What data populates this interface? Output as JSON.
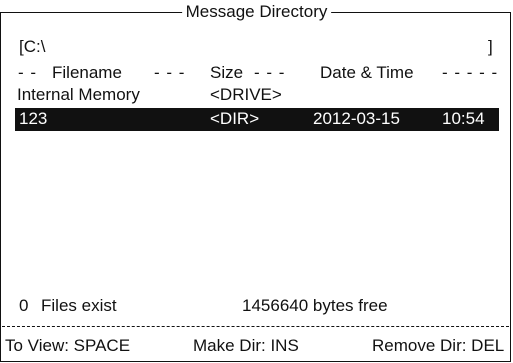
{
  "window": {
    "title": "Message Directory"
  },
  "path": {
    "open_bracket_path": "[C:\\",
    "close_bracket": "]"
  },
  "header": {
    "filename": "Filename",
    "size": "Size",
    "date_time": "Date & Time",
    "leading_dashes": "- -",
    "after_filename_dashes": "- - -",
    "after_size_dashes": "- - -",
    "after_date_dashes": "- - - - -"
  },
  "rows": [
    {
      "filename": "Internal Memory",
      "size": "<DRIVE>",
      "date": "",
      "time": ""
    },
    {
      "filename": "123",
      "size": "<DIR>",
      "date": "2012-03-15",
      "time": "10:54"
    }
  ],
  "status": {
    "files_count": "0",
    "files_text": "Files exist",
    "bytes_free": "1456640 bytes free"
  },
  "commands": {
    "view": "To View: SPACE",
    "make_dir": "Make Dir: INS",
    "remove_dir": "Remove Dir: DEL"
  },
  "colors": {
    "background": "#ffffff",
    "text": "#111111",
    "selection": "#111111",
    "selection_text": "#ffffff"
  }
}
